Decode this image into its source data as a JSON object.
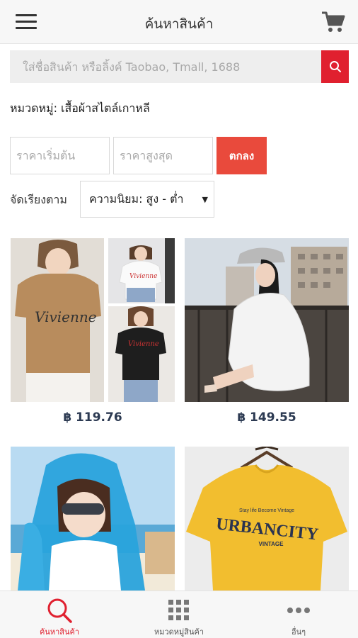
{
  "header": {
    "title": "ค้นหาสินค้า",
    "menu_icon": "hamburger-menu-icon",
    "cart_icon": "shopping-cart-icon"
  },
  "search": {
    "placeholder": "ใส่ชื่อสินค้า หรือลิ้งค์ Taobao, Tmall, 1688",
    "value": "",
    "button_icon": "search-icon",
    "accent": "#e0202f"
  },
  "category": {
    "text": "หมวดหมู่: เสื้อผ้าสไตล์เกาหลี"
  },
  "price_filter": {
    "min_placeholder": "ราคาเริ่มต้น",
    "max_placeholder": "ราคาสูงสุด",
    "ok_label": "ตกลง",
    "ok_color": "#e94a3c"
  },
  "sort": {
    "label": "จัดเรียงตาม",
    "selected": "ความนิยม: สูง - ต่ำ"
  },
  "products": [
    {
      "price": "฿ 119.76",
      "image": "brown-and-black-t-shirt-collage"
    },
    {
      "price": "฿ 149.55",
      "image": "woman-in-white-oversized-shirt-and-cap"
    },
    {
      "price": "",
      "image": "woman-in-blue-hooded-sun-jacket-on-beach"
    },
    {
      "price": "",
      "image": "yellow-urbancity-vintage-t-shirt"
    }
  ],
  "product_texts": {
    "shirt_script": "Vivienne",
    "tee_title": "URBANCITY",
    "tee_sub": "VINTAGE",
    "tee_top": "Stay life Become Vintage"
  },
  "bottom_nav": {
    "items": [
      {
        "label": "ค้นหาสินค้า",
        "icon": "search-icon",
        "active": true
      },
      {
        "label": "หมวดหมู่สินค้า",
        "icon": "grid-icon",
        "active": false
      },
      {
        "label": "อื่นๆ",
        "icon": "more-dots-icon",
        "active": false
      }
    ]
  }
}
